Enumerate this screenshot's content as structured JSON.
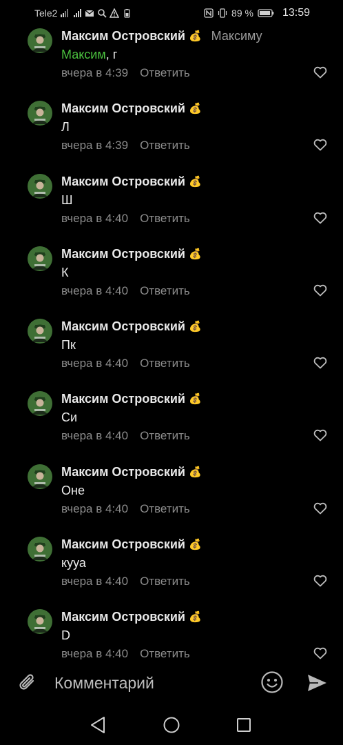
{
  "status_bar": {
    "carrier": "Tele2",
    "battery": "89 %",
    "time": "13:59",
    "icons": [
      "signal-icon",
      "wifi-icon",
      "mail-icon",
      "search-icon",
      "warning-icon",
      "battery-small-icon",
      "nfc-icon",
      "vibrate-icon",
      "battery-icon"
    ]
  },
  "comments": [
    {
      "author": "Максим Островский",
      "badge_icon": "money-bag-icon",
      "badge": "💰",
      "reply_to": "Максиму",
      "mention": "Максим",
      "text": ", г",
      "time": "вчера в 4:39",
      "reply_label": "Ответить"
    },
    {
      "author": "Максим Островский",
      "badge_icon": "money-bag-icon",
      "badge": "💰",
      "reply_to": "",
      "mention": "",
      "text": "Л",
      "time": "вчера в 4:39",
      "reply_label": "Ответить"
    },
    {
      "author": "Максим Островский",
      "badge_icon": "money-bag-icon",
      "badge": "💰",
      "reply_to": "",
      "mention": "",
      "text": "Ш",
      "time": "вчера в 4:40",
      "reply_label": "Ответить"
    },
    {
      "author": "Максим Островский",
      "badge_icon": "money-bag-icon",
      "badge": "💰",
      "reply_to": "",
      "mention": "",
      "text": "К",
      "time": "вчера в 4:40",
      "reply_label": "Ответить"
    },
    {
      "author": "Максим Островский",
      "badge_icon": "money-bag-icon",
      "badge": "💰",
      "reply_to": "",
      "mention": "",
      "text": "Пк",
      "time": "вчера в 4:40",
      "reply_label": "Ответить"
    },
    {
      "author": "Максим Островский",
      "badge_icon": "money-bag-icon",
      "badge": "💰",
      "reply_to": "",
      "mention": "",
      "text": "Си",
      "time": "вчера в 4:40",
      "reply_label": "Ответить"
    },
    {
      "author": "Максим Островский",
      "badge_icon": "money-bag-icon",
      "badge": "💰",
      "reply_to": "",
      "mention": "",
      "text": "Оне",
      "time": "вчера в 4:40",
      "reply_label": "Ответить"
    },
    {
      "author": "Максим Островский",
      "badge_icon": "money-bag-icon",
      "badge": "💰",
      "reply_to": "",
      "mention": "",
      "text": "кууа",
      "time": "вчера в 4:40",
      "reply_label": "Ответить"
    },
    {
      "author": "Максим Островский",
      "badge_icon": "money-bag-icon",
      "badge": "💰",
      "reply_to": "",
      "mention": "",
      "text": "D",
      "time": "вчера в 4:40",
      "reply_label": "Ответить"
    }
  ],
  "composer": {
    "placeholder": "Комментарий",
    "value": "",
    "icons": [
      "paperclip-icon",
      "emoji-icon",
      "send-icon"
    ]
  },
  "navbar": {
    "icons": [
      "back-icon",
      "home-icon",
      "recent-apps-icon"
    ]
  },
  "colors": {
    "background": "#000000",
    "mention": "#4bc33f",
    "muted": "#8c8c8c",
    "text": "#ececec"
  }
}
